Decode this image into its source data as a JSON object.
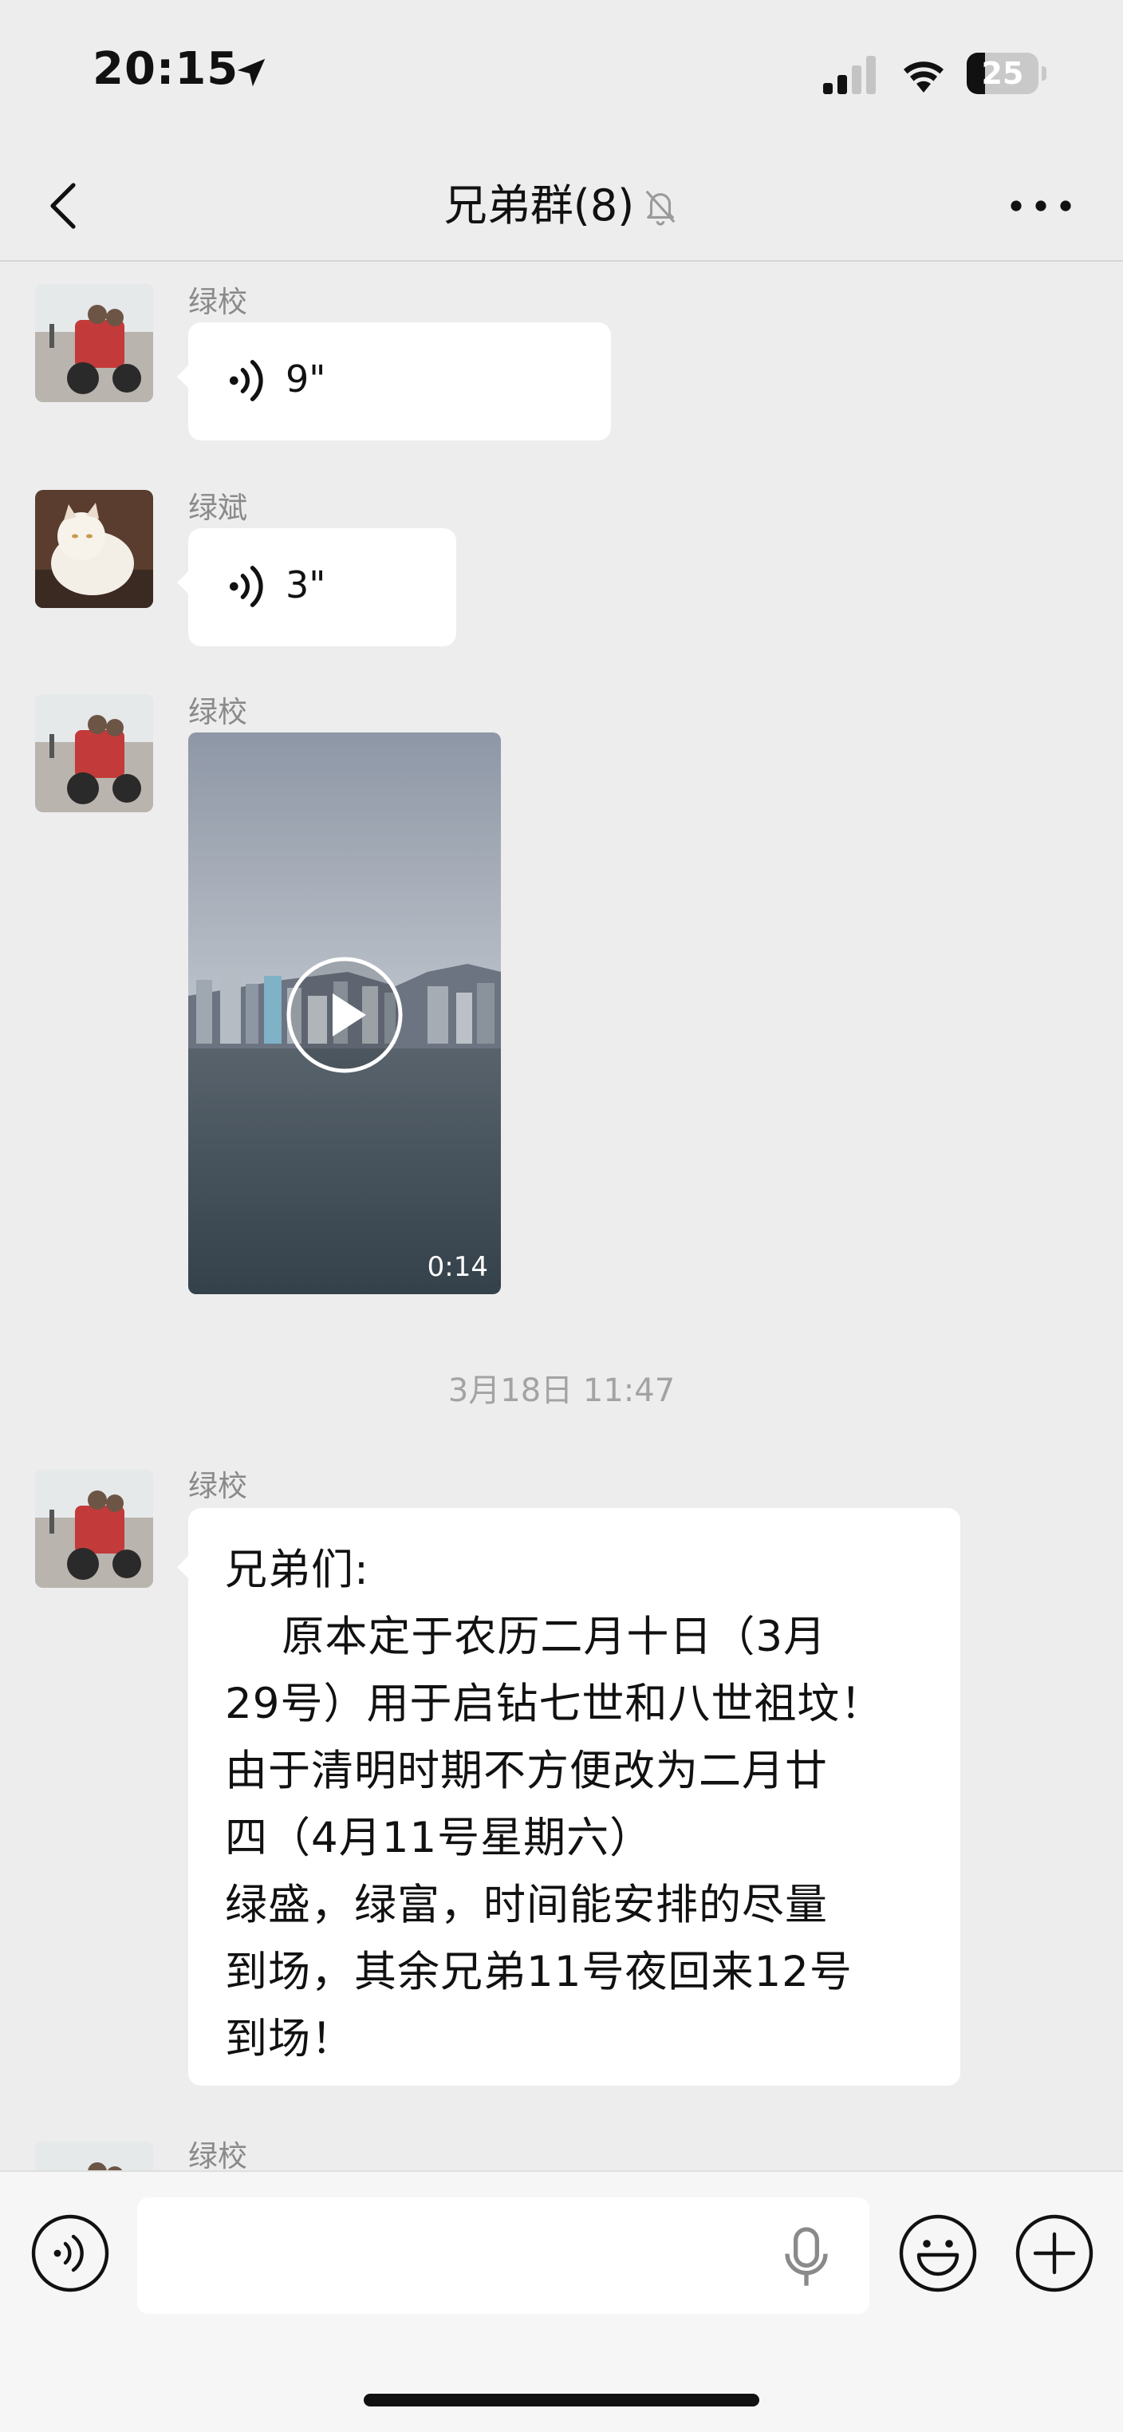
{
  "status_bar": {
    "time": "20:15",
    "battery_level": "25",
    "battery_fraction": 0.25,
    "signal_bars": 2,
    "signal_bars_max": 4
  },
  "nav": {
    "title": "兄弟群(8)",
    "back_icon": "chevron-left-icon",
    "mute_icon": "bell-muted-icon",
    "more_icon": "ellipsis-icon"
  },
  "messages": [
    {
      "sender": "绿校",
      "type": "voice",
      "duration": "9\""
    },
    {
      "sender": "绿斌",
      "type": "voice",
      "duration": "3\""
    },
    {
      "sender": "绿校",
      "type": "video",
      "duration": "0:14"
    },
    {
      "sender": "绿校",
      "type": "text",
      "lines": [
        "兄弟们:",
        "    原本定于农历二月十日（3月",
        "29号）用于启钻七世和八世祖坟！",
        "由于清明时期不方便改为二月廿",
        "四（4月11号星期六）",
        "绿盛，绿富，时间能安排的尽量",
        "到场，其余兄弟11号夜回来12号",
        "到场！"
      ]
    },
    {
      "sender": "绿校",
      "type": "partial"
    }
  ],
  "timestamp": "3月18日 11:47",
  "input_bar": {
    "placeholder": "",
    "icons": [
      "voice-toggle-icon",
      "mic-icon",
      "emoji-icon",
      "plus-icon"
    ]
  },
  "colors": {
    "background": "#ededed",
    "bubble": "#ffffff",
    "name_text": "#8a8a8a",
    "timestamp_text": "#a3a3a3"
  }
}
